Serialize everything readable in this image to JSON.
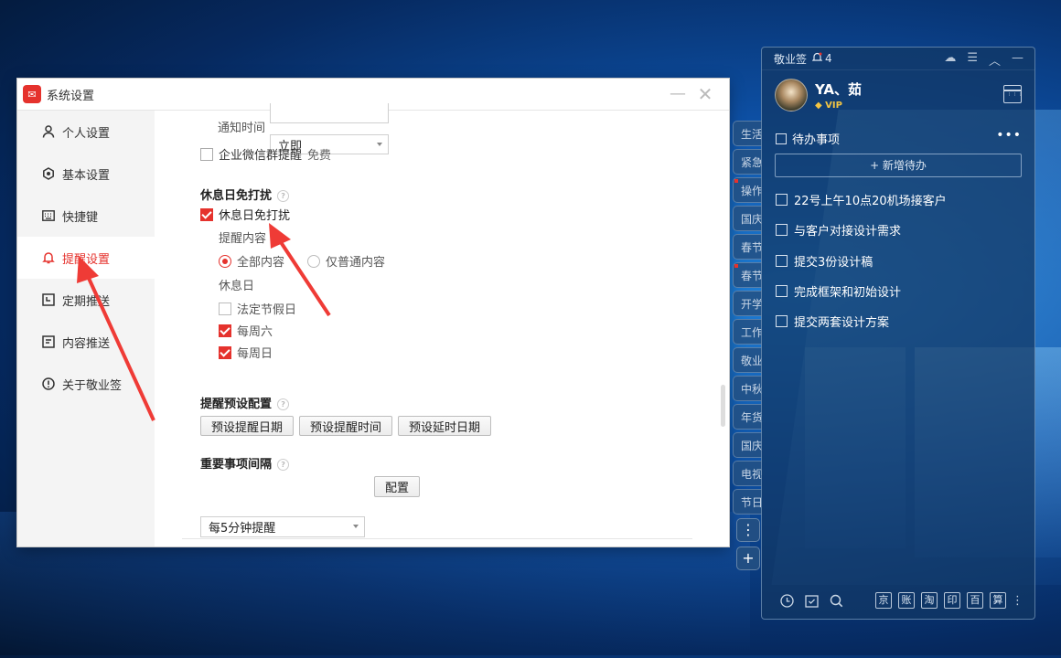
{
  "settings": {
    "title": "系统设置",
    "sidebar": [
      {
        "label": "个人设置",
        "icon": "person-icon"
      },
      {
        "label": "基本设置",
        "icon": "gear-icon"
      },
      {
        "label": "快捷键",
        "icon": "keyboard-icon"
      },
      {
        "label": "提醒设置",
        "icon": "bell-icon"
      },
      {
        "label": "定期推送",
        "icon": "calendar-clock-icon"
      },
      {
        "label": "内容推送",
        "icon": "document-icon"
      },
      {
        "label": "关于敬业签",
        "icon": "info-icon"
      }
    ],
    "notify_time_label": "通知时间",
    "notify_time_value": "立即",
    "wechat_label": "企业微信群提醒",
    "wechat_badge": "免费",
    "rest_title": "休息日免打扰",
    "rest_check_label": "休息日免打扰",
    "remind_content_label": "提醒内容",
    "radio_all": "全部内容",
    "radio_normal": "仅普通内容",
    "restday_label": "休息日",
    "holiday_label": "法定节假日",
    "sat_label": "每周六",
    "sun_label": "每周日",
    "preset_title": "提醒预设配置",
    "preset_btn1": "预设提醒日期",
    "preset_btn2": "预设提醒时间",
    "preset_btn3": "预设延时日期",
    "interval_title": "重要事项间隔",
    "interval_value": "每5分钟提醒",
    "config_btn": "配置"
  },
  "tabs": [
    "生活",
    "紧急",
    "操作",
    "国庆",
    "春节",
    "春节",
    "开学",
    "工作",
    "敬业",
    "中秋",
    "年货",
    "国庆",
    "电视",
    "节日"
  ],
  "panel": {
    "app_name": "敬业签",
    "bell_count": "4",
    "user_name": "YA、茹",
    "vip": "VIP",
    "todo_title": "待办事项",
    "add_label": "+ 新增待办",
    "todos": [
      "22号上午10点20机场接客户",
      "与客户对接设计需求",
      "提交3份设计稿",
      "完成框架和初始设计",
      "提交两套设计方案"
    ],
    "shortcuts": [
      "京",
      "账",
      "淘",
      "印",
      "百",
      "算"
    ]
  },
  "colors": {
    "accent": "#e5322d",
    "panel_bg": "#12376480"
  }
}
